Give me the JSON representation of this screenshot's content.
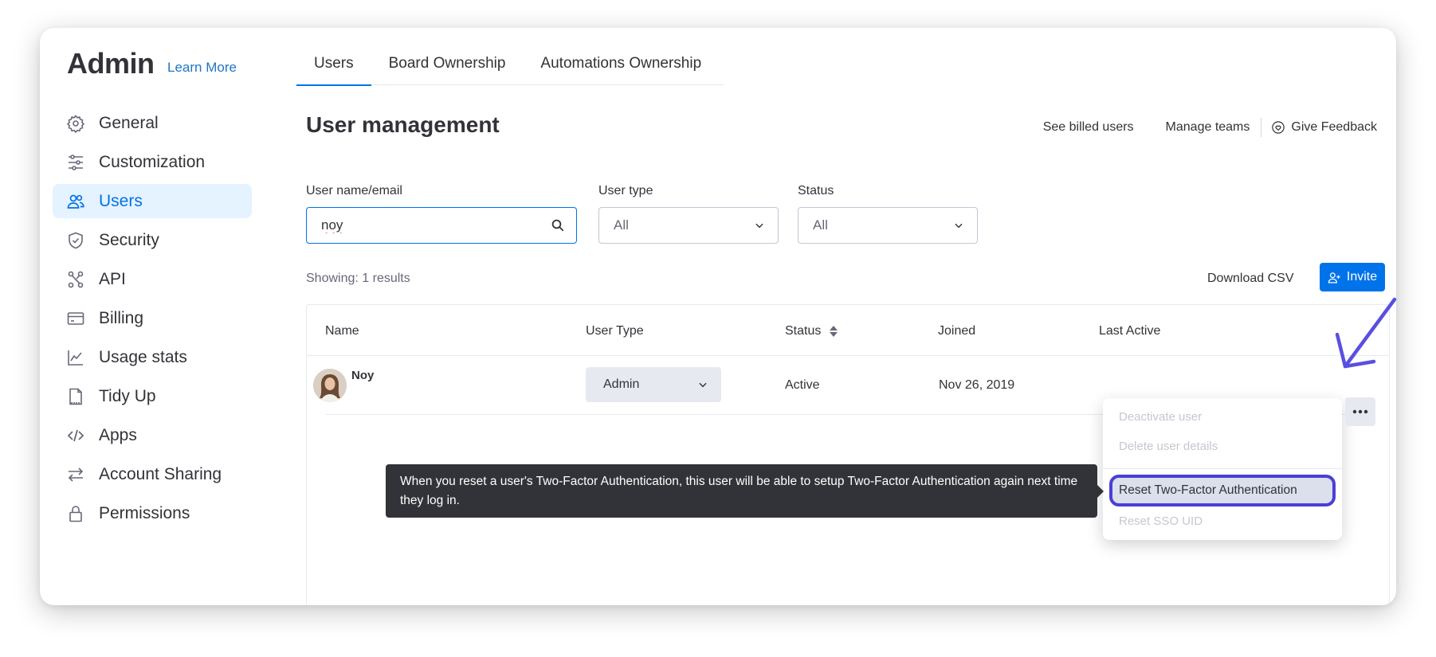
{
  "sidebar": {
    "title": "Admin",
    "learn_more": "Learn More",
    "items": [
      {
        "label": "General",
        "icon": "gear-icon",
        "active": false
      },
      {
        "label": "Customization",
        "icon": "sliders-icon",
        "active": false
      },
      {
        "label": "Users",
        "icon": "users-icon",
        "active": true
      },
      {
        "label": "Security",
        "icon": "shield-icon",
        "active": false
      },
      {
        "label": "API",
        "icon": "api-icon",
        "active": false
      },
      {
        "label": "Billing",
        "icon": "credit-card-icon",
        "active": false
      },
      {
        "label": "Usage stats",
        "icon": "chart-icon",
        "active": false
      },
      {
        "label": "Tidy Up",
        "icon": "document-icon",
        "active": false
      },
      {
        "label": "Apps",
        "icon": "code-icon",
        "active": false
      },
      {
        "label": "Account Sharing",
        "icon": "arrows-icon",
        "active": false
      },
      {
        "label": "Permissions",
        "icon": "lock-icon",
        "active": false
      }
    ]
  },
  "tabs": [
    {
      "label": "Users",
      "active": true
    },
    {
      "label": "Board Ownership",
      "active": false
    },
    {
      "label": "Automations Ownership",
      "active": false
    }
  ],
  "main": {
    "title": "User management",
    "actions": {
      "billed": "See billed users",
      "teams": "Manage teams",
      "feedback": "Give Feedback"
    },
    "filters": {
      "search_label": "User name/email",
      "search_value": "noy",
      "user_type_label": "User type",
      "user_type_value": "All",
      "status_label": "Status",
      "status_value": "All"
    },
    "showing": "Showing: 1 results",
    "download_csv": "Download CSV",
    "invite": "Invite",
    "table": {
      "headers": [
        "Name",
        "User Type",
        "Status",
        "Joined",
        "Last Active"
      ],
      "rows": [
        {
          "name": "Noy",
          "user_type": "Admin",
          "status": "Active",
          "joined": "Nov 26, 2019"
        }
      ]
    }
  },
  "menu": {
    "items": [
      "Deactivate user",
      "Delete user details",
      "Reset Two-Factor Authentication",
      "Reset SSO UID"
    ]
  },
  "tooltip": "When you reset a user's Two-Factor Authentication, this user will be able to setup Two-Factor Authentication again next time they log in.",
  "colors": {
    "accent": "#0073ea",
    "highlight_ring": "#4b3fd6",
    "tooltip_bg": "#323338"
  }
}
